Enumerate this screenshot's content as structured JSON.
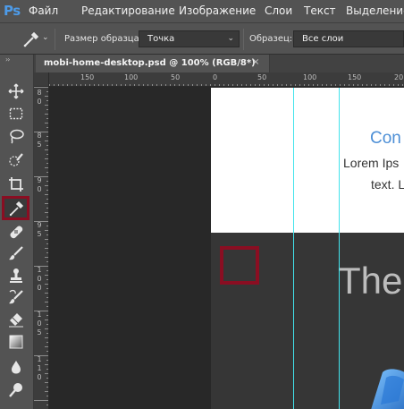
{
  "app": {
    "logo": "Ps"
  },
  "menu": {
    "items": [
      "Файл",
      "Редактирование",
      "Изображение",
      "Слои",
      "Текст",
      "Выделение"
    ]
  },
  "options_bar": {
    "sample_size_label": "Размер образца:",
    "sample_size_value": "Точка",
    "sample_label": "Образец:",
    "sample_value": "Все слои"
  },
  "toolbar": {
    "tools": [
      "move-tool",
      "marquee-tool",
      "lasso-tool",
      "quick-selection-tool",
      "crop-tool",
      "eyedropper-tool",
      "healing-brush-tool",
      "brush-tool",
      "clone-stamp-tool",
      "history-brush-tool",
      "eraser-tool",
      "gradient-tool",
      "blur-tool",
      "dodge-tool"
    ],
    "active_tool": "eyedropper-tool"
  },
  "document": {
    "tab_title": "mobi-home-desktop.psd @ 100% (RGB/8*)",
    "close_glyph": "×"
  },
  "ruler": {
    "h_labels": [
      "150",
      "100",
      "50",
      "0",
      "50",
      "100",
      "150",
      "20"
    ],
    "v_labels": [
      "8",
      "0",
      "8",
      "5",
      "9",
      "0",
      "9",
      "5",
      "1",
      "0",
      "0",
      "1",
      "0",
      "5",
      "1",
      "1",
      "0"
    ]
  },
  "canvas": {
    "heading": "Con",
    "lorem": "Lorem Ips",
    "text": "text. L",
    "hero": "The"
  },
  "colors": {
    "accent_red": "#8a0e22",
    "guide_cyan": "#42e3ec",
    "link_blue": "#4d8fd6",
    "ps_blue": "#4d9be9"
  }
}
